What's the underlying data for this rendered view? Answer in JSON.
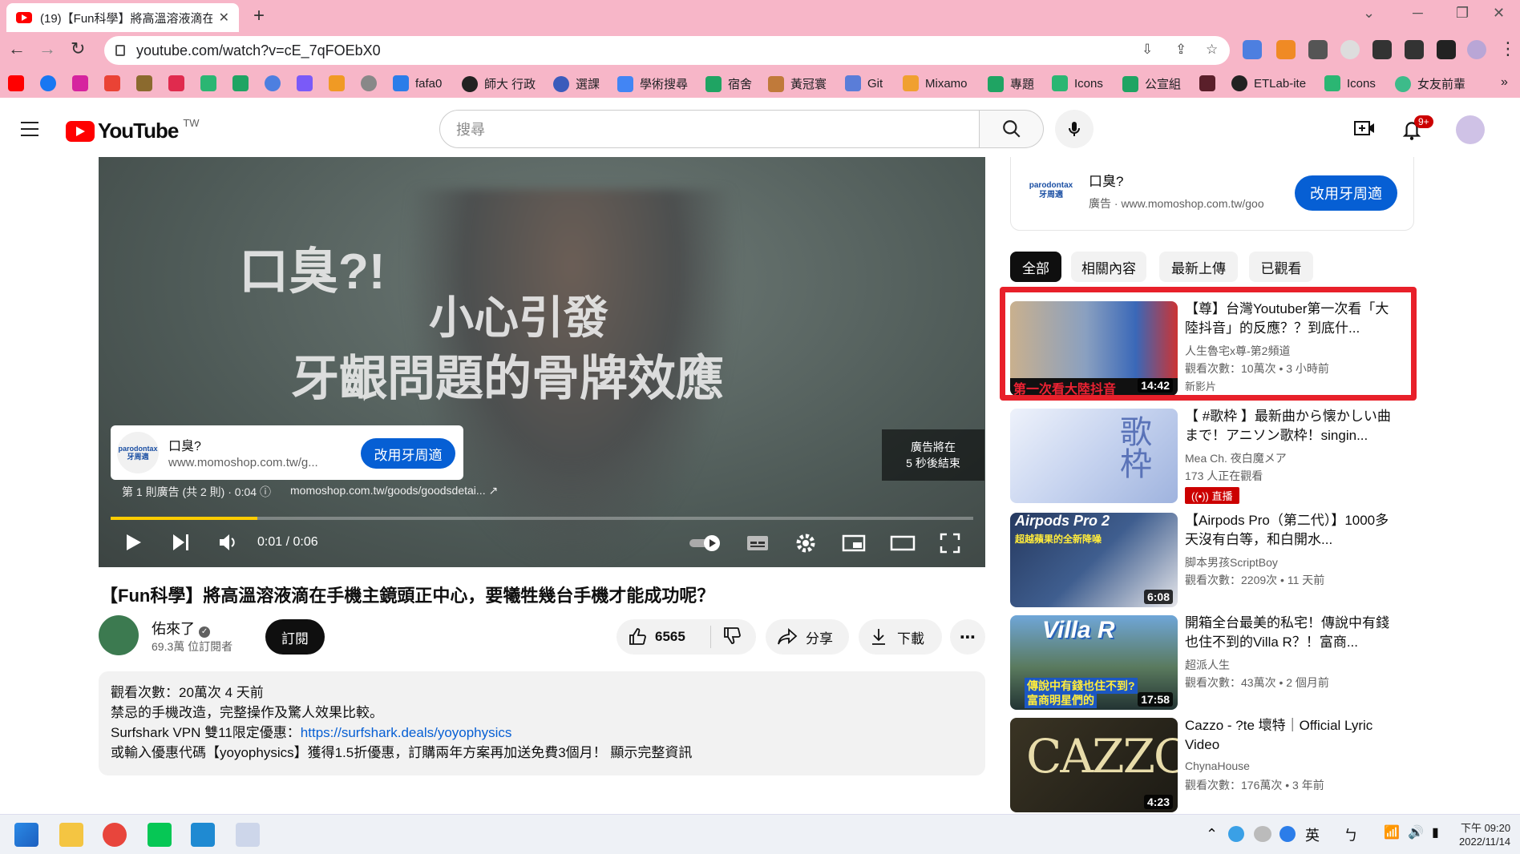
{
  "browser": {
    "tab_title": "(19)【Fun科學】將高溫溶液滴在",
    "new_tab_label": "+",
    "url": "youtube.com/watch?v=cE_7qFOEbX0",
    "bookmarks": [
      "fafa0",
      "師大 行政",
      "選課",
      "學術搜尋",
      "宿舍",
      "黃冠寰",
      "Git",
      "Mixamo",
      "專題",
      "Icons",
      "公宣組",
      "ETLab-ite",
      "Icons",
      "女友前輩"
    ]
  },
  "yt": {
    "logo_text": "YouTube",
    "country": "TW",
    "search_placeholder": "搜尋",
    "notif_badge": "9+"
  },
  "player": {
    "overlay_line1": "口臭?!",
    "overlay_line2": "小心引發",
    "overlay_line3": "牙齦問題的骨牌效應",
    "ad_brand": "parodontax 牙周適",
    "ad_title": "口臭?",
    "ad_url": "www.momoshop.com.tw/g...",
    "ad_button": "改用牙周適",
    "ad_skip_line1": "廣告將在",
    "ad_skip_line2": "5 秒後結束",
    "ad_info": "第 1 則廣告 (共 2 則) · 0:04",
    "ad_domain": "momoshop.com.tw/goods/goodsdetai...",
    "time": "0:01 / 0:06",
    "progress": 0.17
  },
  "video": {
    "title": "【Fun科學】將高溫溶液滴在手機主鏡頭正中心，要犧牲幾台手機才能成功呢？",
    "channel": "佑來了",
    "subscribers": "69.3萬 位訂閱者",
    "subscribe_label": "訂閱",
    "likes": "6565",
    "share_label": "分享",
    "download_label": "下載",
    "desc_stats": "觀看次數：20萬次  4 天前",
    "desc_line1": "禁忌的手機改造，完整操作及驚人效果比較。",
    "desc_line2_prefix": "Surfshark VPN 雙11限定優惠：",
    "desc_link": "https://surfshark.deals/yoyophysics",
    "desc_line3": "或輸入優惠代碼【yoyophysics】獲得1.5折優惠，訂購兩年方案再加送免費3個月！",
    "desc_more": "顯示完整資訊"
  },
  "sidebar_ad": {
    "brand": "parodontax 牙周適",
    "title": "口臭?",
    "sponsor": "廣告 · www.momoshop.com.tw/goo",
    "button": "改用牙周適"
  },
  "chips": [
    "全部",
    "相關內容",
    "最新上傳",
    "已觀看"
  ],
  "recommendations": [
    {
      "title": "【尊】台灣Youtuber第一次看「大陸抖音」的反應？？到底什...",
      "channel": "人生魯宅x尊-第2頻道",
      "meta": "觀看次數：10萬次 • 3 小時前",
      "duration": "14:42",
      "extra": "新影片"
    },
    {
      "title": "【 #歌枠 】最新曲から懐かしい曲まで！アニソン歌枠！singin...",
      "channel": "Mea Ch. 夜白魔メア",
      "meta": "173 人正在觀看",
      "duration": "",
      "live": "直播"
    },
    {
      "title": "【Airpods Pro（第二代）】1000多天沒有白等，和白開水...",
      "channel": "脚本男孩ScriptBoy",
      "meta": "觀看次數：2209次 • 11 天前",
      "duration": "6:08"
    },
    {
      "title": "開箱全台最美的私宅！傳說中有錢也住不到的Villa R？！富商...",
      "channel": "超派人生",
      "meta": "觀看次數：43萬次 • 2 個月前",
      "duration": "17:58"
    },
    {
      "title": "Cazzo - ?te 壞特｜Official Lyric Video",
      "channel": "ChynaHouse",
      "meta": "觀看次數：176萬次 • 3 年前",
      "duration": "4:23"
    }
  ],
  "thumb_text": {
    "t0": "第一次看大陸抖音",
    "t2a": "Airpods Pro 2",
    "t2b": "超越蘋果的全新降噪",
    "t3a": "Villa R",
    "t3b": "傳說中有錢也住不到?",
    "t3c": "富商明星們的",
    "t4": "CAZZO",
    "t1": "歌枠"
  },
  "taskbar": {
    "ime": "英",
    "time": "下午 09:20",
    "date": "2022/11/14"
  }
}
